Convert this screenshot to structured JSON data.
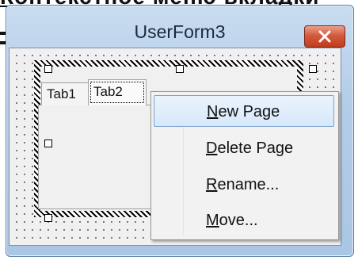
{
  "background_snippet": "Контекстное меню вкладки",
  "window": {
    "title": "UserForm3",
    "close_icon": "close-icon"
  },
  "multipage": {
    "tabs": [
      {
        "label": "Tab1"
      },
      {
        "label": "Tab2"
      }
    ]
  },
  "context_menu": {
    "items": [
      {
        "label_u": "N",
        "label_rest": "ew Page",
        "highlighted": true
      },
      {
        "label_u": "D",
        "label_rest": "elete Page",
        "highlighted": false
      },
      {
        "label_u": "R",
        "label_rest": "ename...",
        "highlighted": false
      },
      {
        "label_u": "M",
        "label_rest": "ove...",
        "highlighted": false
      }
    ]
  },
  "colors": {
    "menu_highlight_border": "#7da2ce",
    "close_button": "#c23c1e",
    "window_frame": "#b3cde8"
  }
}
